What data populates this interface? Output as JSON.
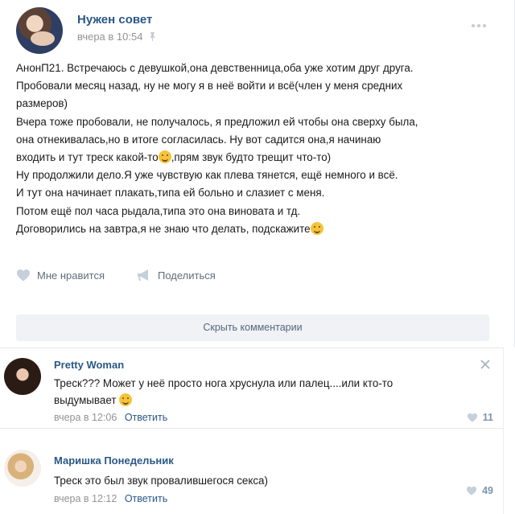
{
  "post": {
    "author": "Нужен совет",
    "time": "вчера в 10:54",
    "lines": [
      "АнонП21. Встречаюсь с девушкой,она девственница,оба уже хотим друг друга.",
      "Пробовали месяц назад, ну не могу я в неё войти и всё(член у меня средних",
      "размеров)",
      "Вчера тоже пробовали, не получалось, я предложил ей чтобы она сверху была,",
      "она отнекивалась,но в итоге согласилась. Ну вот садится она,я начинаю",
      "входить и тут треск какой-то",
      ",прям звук будто трещит что-то)",
      "Ну продолжили дело.Я уже чувствую как плева тянется, ещё немного и всё.",
      "И тут она начинает плакать,типа ей больно и слазиет с меня.",
      "Потом ещё пол часа рыдала,типа это она виновата и тд.",
      "Договорились на завтра,я не знаю что делать, подскажите"
    ],
    "like_label": "Мне нравится",
    "share_label": "Поделиться",
    "hide_comments_label": "Скрыть комментарии"
  },
  "comments": [
    {
      "author": "Pretty Woman",
      "text_line1": "Треск??? Может у неё просто нога хруснула или палец....или кто-то",
      "text_line2": "выдумывает",
      "time": "вчера в 12:06",
      "reply_label": "Ответить",
      "likes": "11"
    },
    {
      "author": "Маришка Понедельник",
      "text_line1": "Треск это был звук провалившегося секса)",
      "time": "вчера в 12:12",
      "reply_label": "Ответить",
      "likes": "49"
    }
  ],
  "icons": {
    "heart": "heart-icon",
    "share": "megaphone-icon",
    "more": "more-dots-icon",
    "close": "close-icon",
    "pin": "pin-icon",
    "emoji": "emoji-icon"
  },
  "colors": {
    "link": "#2a5885",
    "muted": "#939393",
    "button_bg": "#f0f2f5",
    "like_count": "#7e94ad"
  }
}
